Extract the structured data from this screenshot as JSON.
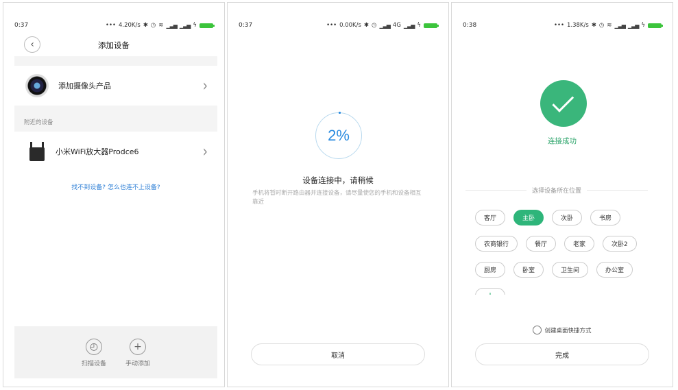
{
  "panel1": {
    "status": {
      "time": "0:37",
      "speed": "4.20K/s"
    },
    "title": "添加设备",
    "camera_row": {
      "label": "添加摄像头产品"
    },
    "nearby_section": "附近的设备",
    "device_row": {
      "label": "小米WiFi放大器Prodce6"
    },
    "help_link": "找不到设备? 怎么也连不上设备?",
    "bottom": {
      "scan_label": "扫描设备",
      "manual_label": "手动添加"
    }
  },
  "panel2": {
    "status": {
      "time": "0:37",
      "speed": "0.00K/s",
      "network": "4G"
    },
    "progress": "2%",
    "title": "设备连接中，请稍候",
    "description": "手机将暂时断开路由器并连接设备，请尽量使您的手机和设备相互靠近",
    "cancel_label": "取消"
  },
  "panel3": {
    "status": {
      "time": "0:38",
      "speed": "1.38K/s"
    },
    "success_text": "连接成功",
    "location_title": "选择设备所在位置",
    "rooms": [
      {
        "label": "客厅",
        "selected": false
      },
      {
        "label": "主卧",
        "selected": true
      },
      {
        "label": "次卧",
        "selected": false
      },
      {
        "label": "书房",
        "selected": false
      },
      {
        "label": "农商银行",
        "selected": false
      },
      {
        "label": "餐厅",
        "selected": false
      },
      {
        "label": "老家",
        "selected": false
      },
      {
        "label": "次卧2",
        "selected": false
      },
      {
        "label": "厨房",
        "selected": false
      },
      {
        "label": "卧室",
        "selected": false
      },
      {
        "label": "卫生间",
        "selected": false
      },
      {
        "label": "办公室",
        "selected": false
      }
    ],
    "shortcut_label": "创建桌面快捷方式",
    "done_label": "完成",
    "accent_color": "#2eb57a"
  }
}
